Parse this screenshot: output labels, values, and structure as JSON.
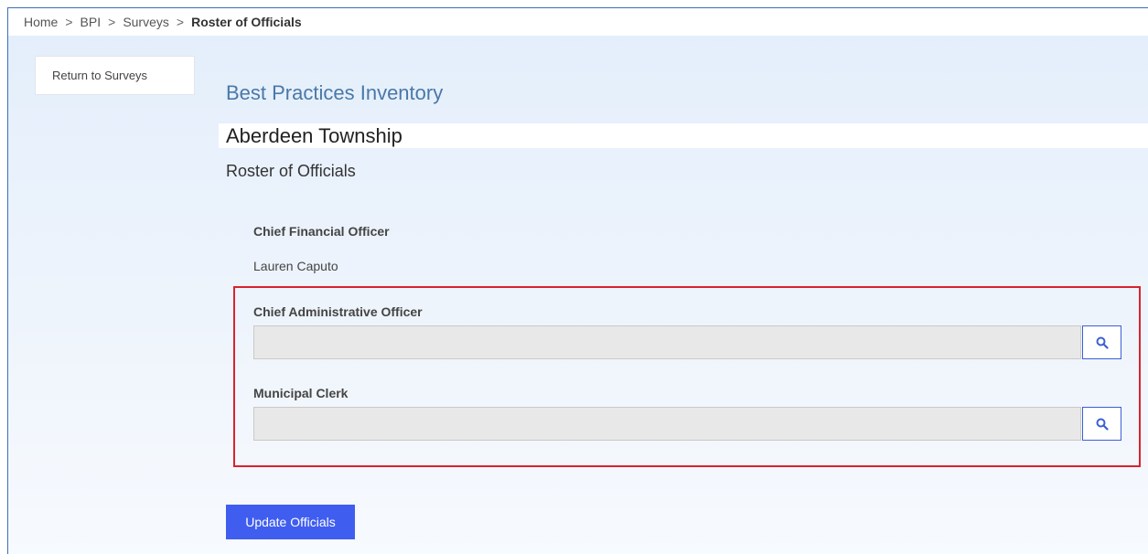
{
  "breadcrumb": {
    "items": [
      "Home",
      "BPI",
      "Surveys"
    ],
    "separator": ">",
    "current": "Roster of Officials"
  },
  "sidebar": {
    "return_label": "Return to Surveys"
  },
  "header": {
    "title": "Best Practices Inventory",
    "municipality": "Aberdeen Township",
    "section": "Roster of Officials"
  },
  "officials": {
    "cfo": {
      "label": "Chief Financial Officer",
      "value": "Lauren Caputo"
    },
    "cao": {
      "label": "Chief Administrative Officer",
      "value": ""
    },
    "clerk": {
      "label": "Municipal Clerk",
      "value": ""
    }
  },
  "actions": {
    "update_label": "Update Officials"
  },
  "icons": {
    "search": "search-icon"
  },
  "colors": {
    "accent": "#3f5ef0",
    "highlight": "#d9232e",
    "title": "#4a78a8"
  }
}
